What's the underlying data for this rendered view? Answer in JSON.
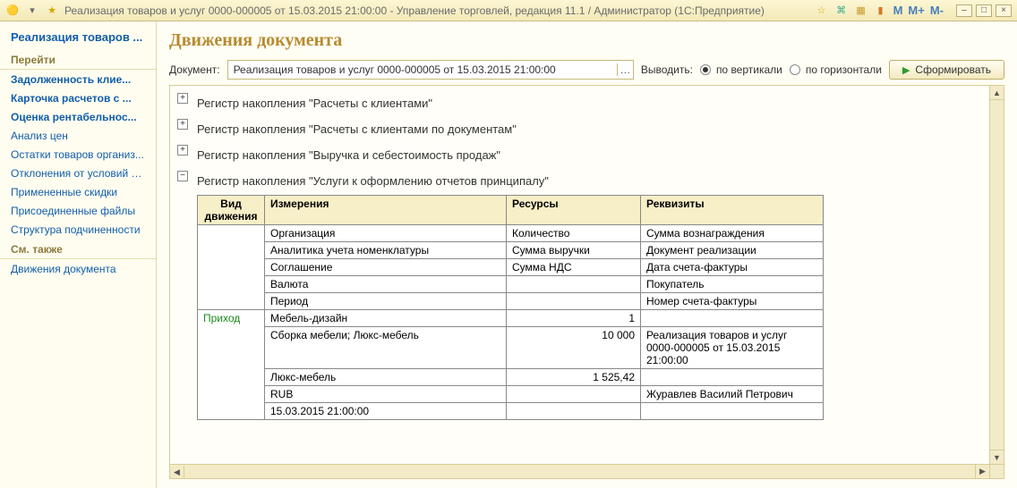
{
  "window": {
    "title": "Реализация товаров и услуг 0000-000005 от 15.03.2015 21:00:00 - Управление торговлей, редакция 11.1 / Администратор  (1С:Предприятие)"
  },
  "sidebar": {
    "heading": "Реализация товаров ...",
    "sec_go": "Перейти",
    "items_go": [
      "Задолженность клие...",
      "Карточка расчетов с ...",
      "Оценка рентабельнос...",
      "Анализ цен",
      "Остатки товаров организ...",
      "Отклонения от условий пр...",
      "Примененные скидки",
      "Присоединенные файлы",
      "Структура подчиненности"
    ],
    "sec_see": "См. также",
    "items_see": [
      "Движения документа"
    ]
  },
  "main": {
    "title": "Движения документа",
    "doc_label": "Документ:",
    "doc_value": "Реализация товаров и услуг 0000-000005 от 15.03.2015 21:00:00",
    "output_label": "Выводить:",
    "radio_vert": "по вертикали",
    "radio_horiz": "по горизонтали",
    "btn_run": "Сформировать"
  },
  "report": {
    "reg1": "Регистр накопления \"Расчеты с клиентами\"",
    "reg2": "Регистр накопления \"Расчеты с клиентами по документам\"",
    "reg3": "Регистр накопления \"Выручка и себестоимость продаж\"",
    "reg4": "Регистр накопления \"Услуги к оформлению отчетов принципалу\"",
    "headers": {
      "move": "Вид движения",
      "dims": "Измерения",
      "res": "Ресурсы",
      "req": "Реквизиты"
    },
    "dim_labels": [
      "Организация",
      "Аналитика учета номенклатуры",
      "Соглашение",
      "Валюта",
      "Период"
    ],
    "res_labels": [
      "Количество",
      "Сумма выручки",
      "Сумма НДС"
    ],
    "req_labels": [
      "Сумма вознаграждения",
      "Документ реализации",
      "Дата счета-фактуры",
      "Покупатель",
      "Номер счета-фактуры"
    ],
    "move_type": "Приход",
    "dim_vals": [
      "Мебель-дизайн",
      "Сборка мебели; Люкс-мебель",
      "Люкс-мебель",
      "RUB",
      "15.03.2015 21:00:00"
    ],
    "res_vals": [
      "1",
      "10 000",
      "1 525,42"
    ],
    "req_vals": [
      "",
      "Реализация товаров и услуг 0000-000005 от 15.03.2015 21:00:00",
      "",
      "Журавлев Василий Петрович",
      ""
    ]
  }
}
